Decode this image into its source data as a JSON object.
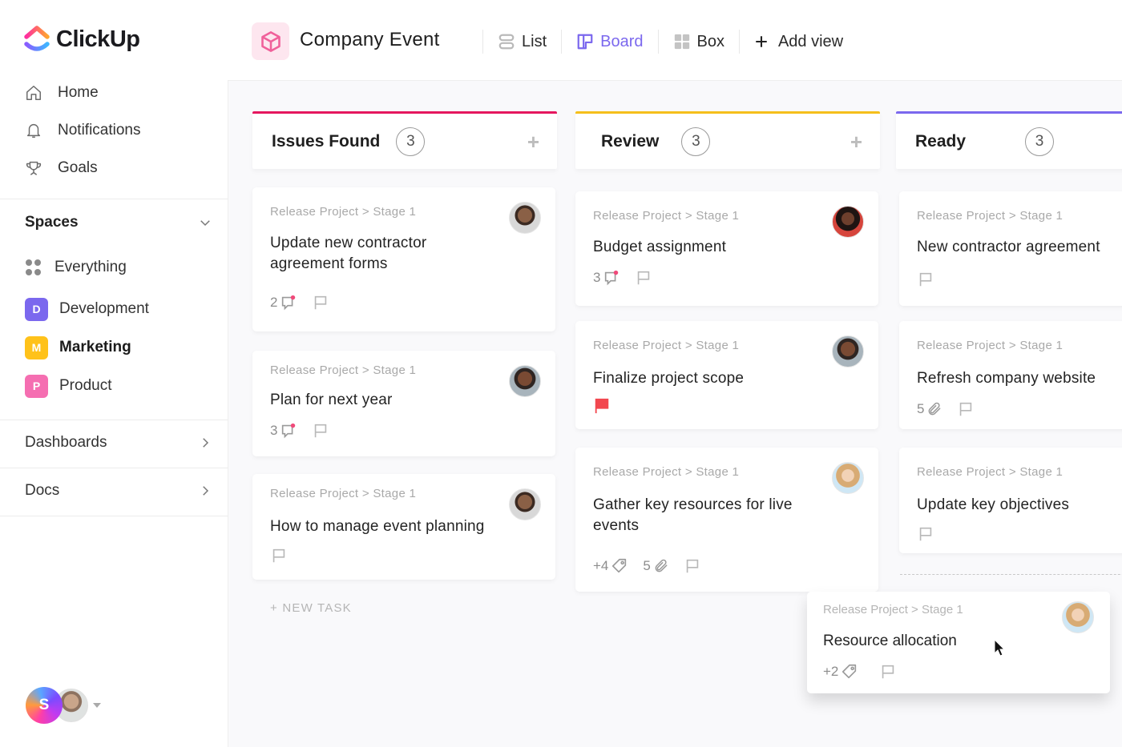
{
  "app": {
    "brand": "ClickUp"
  },
  "sidebar": {
    "nav": [
      {
        "label": "Home",
        "icon": "home-icon"
      },
      {
        "label": "Notifications",
        "icon": "bell-icon"
      },
      {
        "label": "Goals",
        "icon": "trophy-icon"
      }
    ],
    "spaces_label": "Spaces",
    "everything_label": "Everything",
    "spaces": [
      {
        "initial": "D",
        "label": "Development",
        "color": "#7b68ee",
        "active": false
      },
      {
        "initial": "M",
        "label": "Marketing",
        "color": "#ffc21a",
        "active": true
      },
      {
        "initial": "P",
        "label": "Product",
        "color": "#f56eb1",
        "active": false
      }
    ],
    "dashboards_label": "Dashboards",
    "docs_label": "Docs",
    "user_initial": "S"
  },
  "header": {
    "project_title": "Company Event",
    "views": [
      {
        "label": "List",
        "icon": "list-icon",
        "active": false
      },
      {
        "label": "Board",
        "icon": "board-icon",
        "active": true
      },
      {
        "label": "Box",
        "icon": "box-icon",
        "active": false
      }
    ],
    "add_view_label": "Add view",
    "accent": "#7b68ee"
  },
  "board": {
    "columns": [
      {
        "title": "Issues Found",
        "count": "3",
        "color": "#e5175e",
        "cards": [
          {
            "crumb": "Release Project > Stage 1",
            "title": "Update new contractor agreement forms",
            "comments": "2",
            "comment_unread": true
          },
          {
            "crumb": "Release Project > Stage 1",
            "title": "Plan for next year",
            "comments": "3",
            "comment_unread": true
          },
          {
            "crumb": "Release Project > Stage 1",
            "title": "How to manage event planning"
          }
        ],
        "new_task_label": "+ NEW TASK"
      },
      {
        "title": "Review",
        "count": "3",
        "color": "#f5bf1b",
        "cards": [
          {
            "crumb": "Release Project > Stage 1",
            "title": "Budget assignment",
            "comments": "3",
            "comment_unread": true
          },
          {
            "crumb": "Release Project > Stage 1",
            "title": "Finalize project scope",
            "priority": "urgent"
          },
          {
            "crumb": "Release Project > Stage 1",
            "title": "Gather key resources for live events",
            "tags": "+4",
            "attachments": "5"
          }
        ]
      },
      {
        "title": "Ready",
        "count": "3",
        "color": "#7b68ee",
        "cards": [
          {
            "crumb": "Release Project > Stage 1",
            "title": "New contractor agreement"
          },
          {
            "crumb": "Release Project > Stage 1",
            "title": "Refresh company website",
            "attachments": "5"
          },
          {
            "crumb": "Release Project > Stage 1",
            "title": "Update key objectives"
          }
        ]
      }
    ],
    "dragging_card": {
      "crumb": "Release Project > Stage 1",
      "title": "Resource allocation",
      "tags": "+2"
    }
  }
}
